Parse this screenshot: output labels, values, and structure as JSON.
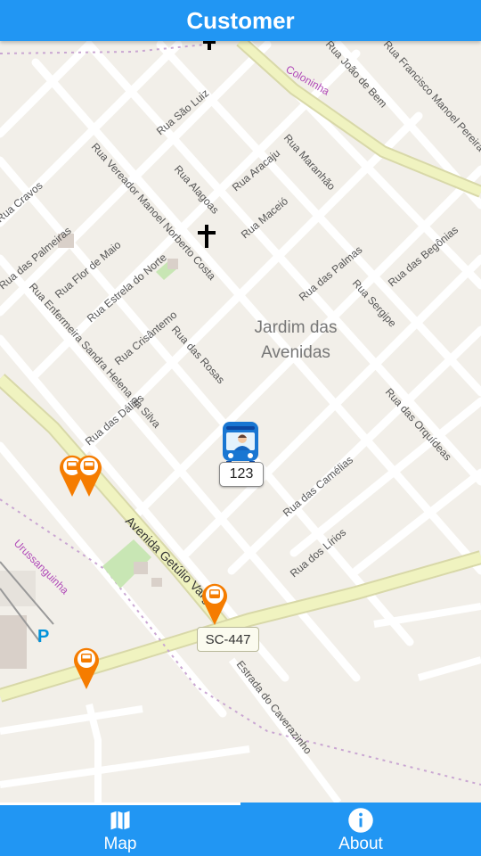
{
  "header": {
    "title": "Customer"
  },
  "map": {
    "district_label_line1": "Jardim das",
    "district_label_line2": "Avenidas",
    "streets": [
      "Rua São Luiz",
      "Rua Aracaju",
      "Rua Maranhão",
      "Rua Alagoas",
      "Rua Maceió",
      "Rua Vereador Manoel Norberto Costa",
      "Rua Estrela do Norte",
      "Rua Flor de Maio",
      "Rua Crisântemo",
      "Rua das Rosas",
      "Rua Enfermeira Sandra Helena da Silva",
      "Rua das Palmeiras",
      "Rua das Palmas",
      "Rua Sergipe",
      "Rua das Begônias",
      "Rua das Orquídeas",
      "Rua das Camélias",
      "Rua dos Lírios",
      "Avenida Getúlio Vargas",
      "Estrada do Caverazinho",
      "Coloninha",
      "Urussanguinha",
      "Rua João de Bem",
      "Rua Francisco Manoel Pereira",
      "Rua das Dálias",
      "Rua Cravos"
    ],
    "road_shield": "SC-447",
    "bus_number": "123",
    "parking_symbol": "P",
    "icons": [
      "church-icon",
      "bus-stop-pin-icon",
      "bus-avatar-icon",
      "parking-icon"
    ]
  },
  "tabs": [
    {
      "label": "Map",
      "icon": "map-icon",
      "active": true
    },
    {
      "label": "About",
      "icon": "info-icon",
      "active": false
    }
  ],
  "colors": {
    "primary": "#2196f3",
    "pin": "#f57c00",
    "bus": "#1976d2",
    "map_bg": "#f2efe9",
    "main_road": "#f0f3c0"
  }
}
